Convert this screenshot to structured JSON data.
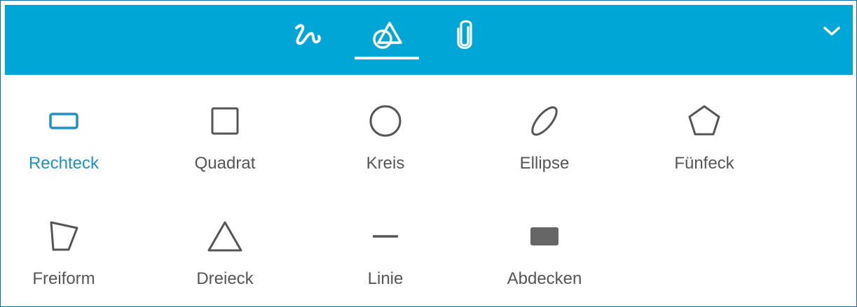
{
  "header": {
    "tabs": [
      {
        "id": "freehand",
        "icon": "scribble-icon",
        "selected": false
      },
      {
        "id": "shapes",
        "icon": "shapes-icon",
        "selected": true
      },
      {
        "id": "attach",
        "icon": "paperclip-icon",
        "selected": false
      }
    ],
    "collapse_icon": "chevron-down-icon"
  },
  "tools": [
    {
      "label": "Rechteck",
      "icon": "rectangle-icon",
      "active": true
    },
    {
      "label": "Quadrat",
      "icon": "square-icon",
      "active": false
    },
    {
      "label": "Kreis",
      "icon": "circle-icon",
      "active": false
    },
    {
      "label": "Ellipse",
      "icon": "ellipse-icon",
      "active": false
    },
    {
      "label": "Fünfeck",
      "icon": "pentagon-icon",
      "active": false
    },
    {
      "label": "Freiform",
      "icon": "freeform-icon",
      "active": false
    },
    {
      "label": "Dreieck",
      "icon": "triangle-icon",
      "active": false
    },
    {
      "label": "Linie",
      "icon": "line-icon",
      "active": false
    },
    {
      "label": "Abdecken",
      "icon": "cover-icon",
      "active": false
    }
  ],
  "colors": {
    "header_bg": "#00a6d6",
    "accent": "#1f92c4",
    "icon_gray": "#555555",
    "label_gray": "#555555"
  }
}
